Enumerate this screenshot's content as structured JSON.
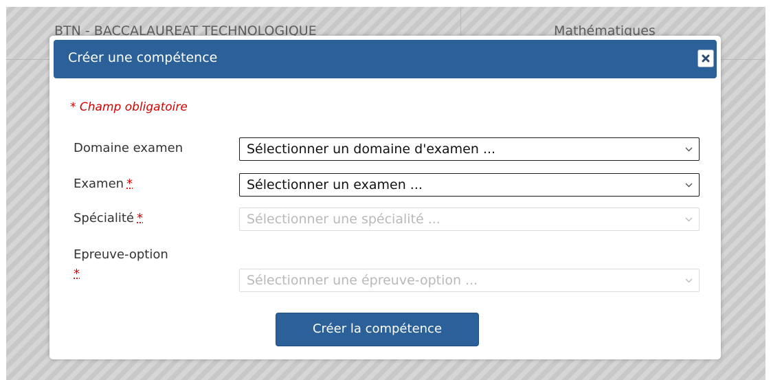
{
  "background": {
    "cells": [
      "BTN - BACCALAUREAT TECHNOLOGIQUE",
      "Mathématiques"
    ]
  },
  "modal": {
    "title": "Créer une compétence",
    "close_icon": "close-icon",
    "required_note": "* Champ obligatoire",
    "fields": [
      {
        "label": "Domaine examen",
        "required": false,
        "placeholder": "Sélectionner un domaine d'examen ...",
        "enabled": true
      },
      {
        "label": "Examen",
        "required": true,
        "placeholder": "Sélectionner un examen ...",
        "enabled": true
      },
      {
        "label": "Spécialité",
        "required": true,
        "placeholder": "Sélectionner une spécialité ...",
        "enabled": false
      },
      {
        "label": "Epreuve-option",
        "required": true,
        "placeholder": "Sélectionner une épreuve-option ...",
        "enabled": false
      }
    ],
    "required_marker": "*",
    "submit_label": "Créer la compétence"
  },
  "colors": {
    "header": "#2b6099",
    "required": "#d40000"
  }
}
